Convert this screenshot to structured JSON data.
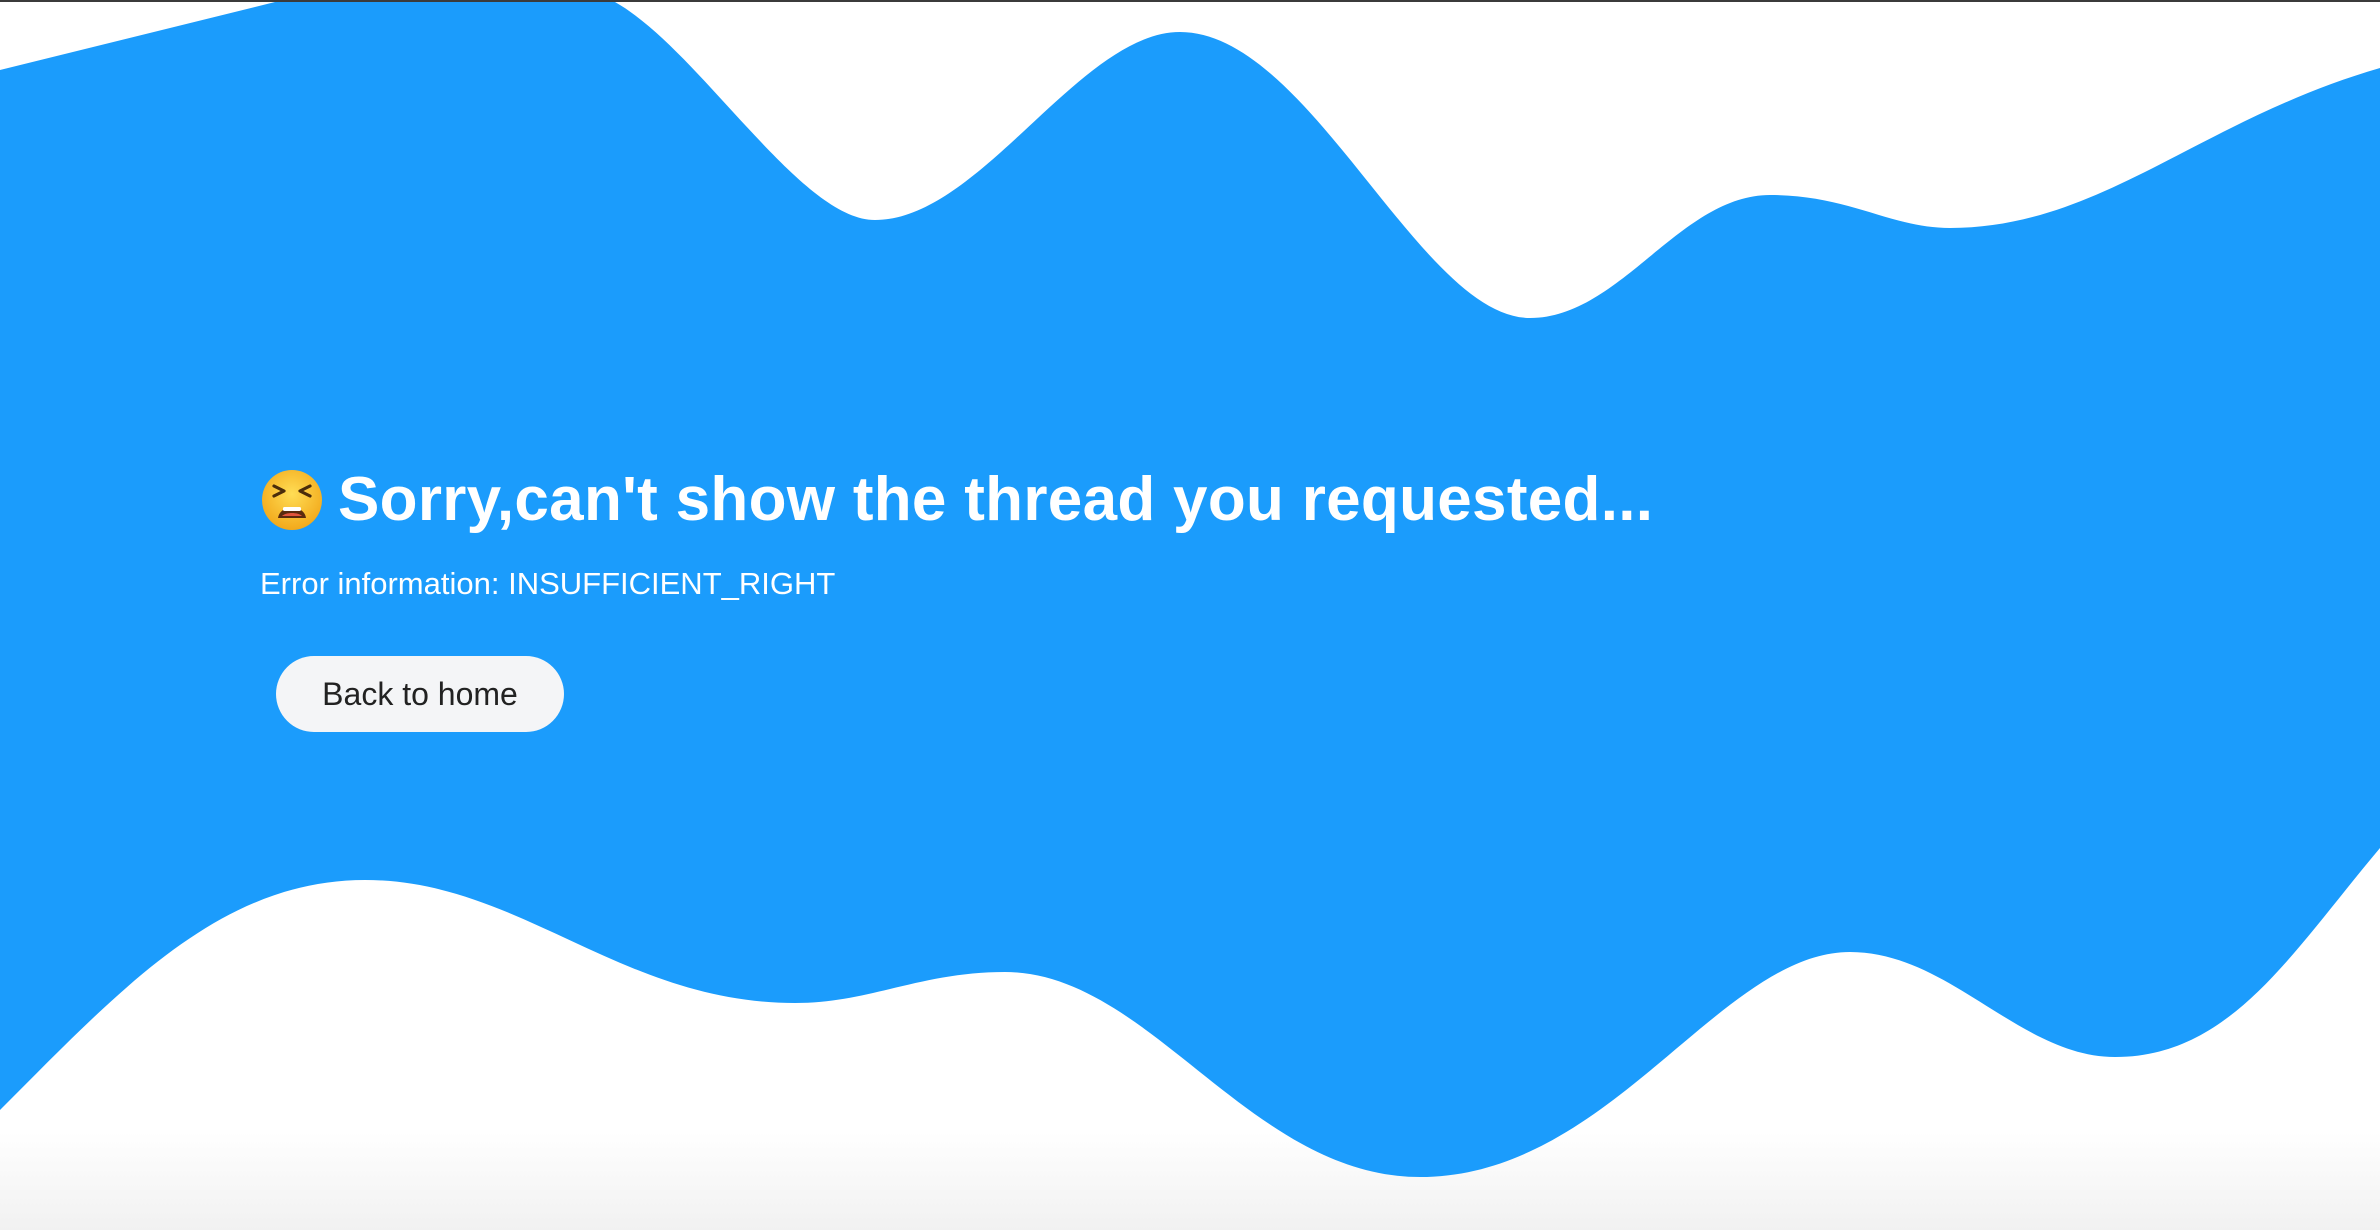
{
  "colors": {
    "wave": "#1b9cfc",
    "text": "#ffffff",
    "button_bg": "#f4f5f7",
    "button_text": "#222222"
  },
  "error": {
    "icon": "tired-face-icon",
    "title": "Sorry,can't show the thread you requested...",
    "info": "Error information: INSUFFICIENT_RIGHT"
  },
  "actions": {
    "home_label": "Back to home"
  }
}
